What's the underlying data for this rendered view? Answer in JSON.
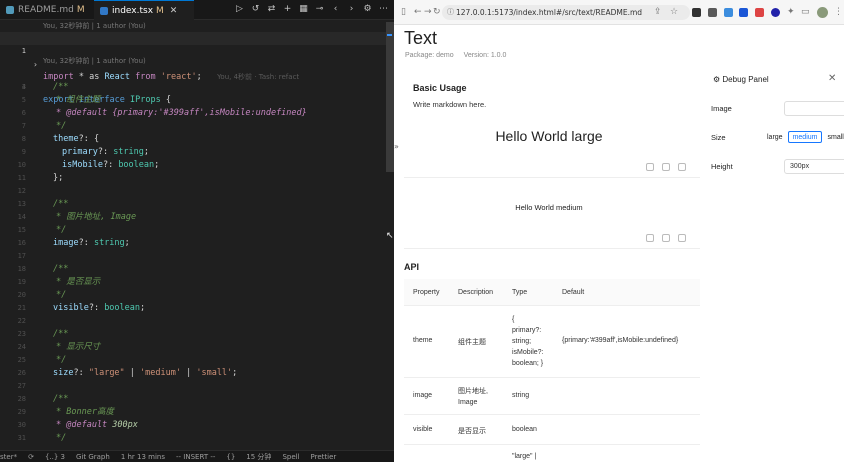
{
  "editor": {
    "tabs": [
      {
        "label": "README.md",
        "modified": "M",
        "icon_color": "#519aba"
      },
      {
        "label": "index.tsx",
        "modified": "M",
        "icon_color": "#3178c6"
      }
    ],
    "blame_top": "You, 32秒钟前 | 1 author (You)",
    "blame_mid": "You, 32秒钟前 | 1 author (You)",
    "ghost_text": "You, 4秒前 · Tash: refact",
    "line_numbers": [
      "1",
      "2",
      "3",
      "4",
      "5",
      "6",
      "7",
      "8",
      "9",
      "10",
      "11",
      "12",
      "13",
      "14",
      "15",
      "16",
      "17",
      "18",
      "19",
      "20",
      "21",
      "22",
      "23",
      "24",
      "25",
      "26",
      "27",
      "28",
      "29",
      "30",
      "31",
      "32"
    ],
    "code": {
      "l1": [
        "import",
        " * as ",
        "React",
        " from ",
        "'react'",
        ";"
      ],
      "l2_blank": "",
      "l3": [
        "export",
        " interface ",
        "IProps",
        " {"
      ],
      "l4": "/**",
      "l5": "* 组件主题",
      "l6_kw": "* @default",
      "l6_val": " {primary:'#399aff',isMobile:undefined}",
      "l7": "*/",
      "l8": [
        "theme",
        "?: {"
      ],
      "l9": [
        "primary",
        "?: ",
        "string",
        ";"
      ],
      "l10": [
        "isMobile",
        "?: ",
        "boolean",
        ";"
      ],
      "l11": "};",
      "l13": "/**",
      "l14": "* 图片地址, Image",
      "l15": "*/",
      "l16": [
        "image",
        "?: ",
        "string",
        ";"
      ],
      "l18": "/**",
      "l19": "* 是否显示",
      "l20": "*/",
      "l21": [
        "visible",
        "?: ",
        "boolean",
        ";"
      ],
      "l23": "/**",
      "l24": "* 显示尺寸",
      "l25": "*/",
      "l26": [
        "size",
        "?: ",
        "\"large\"",
        " | ",
        "'medium'",
        " | ",
        "'small'",
        ";"
      ],
      "l28": "/**",
      "l29": "* Bonner高度",
      "l30_kw": "* @default",
      "l30_val": " 300px",
      "l31": "*/"
    },
    "status": {
      "branch": "ster*",
      "sync": "⟳",
      "problems": "{..} 3",
      "git_graph": "Git Graph",
      "time": "1 hr 13 mins",
      "mode": "-- INSERT --",
      "braces": "{}",
      "ago": "15 分钟",
      "spell": "Spell",
      "prettier": "Prettier"
    }
  },
  "browser": {
    "url": "127.0.0.1:5173/index.html#/src/text/README.md",
    "doc_title": "Text",
    "package": "Package: demo",
    "version": "Version: 1.0.0",
    "basic_usage_title": "Basic Usage",
    "basic_usage_desc": "Write markdown here.",
    "demo_large": "Hello World large",
    "demo_medium": "Hello World medium",
    "api_title": "API",
    "table_headers": [
      "Property",
      "Description",
      "Type",
      "Default"
    ],
    "rows": [
      {
        "property": "theme",
        "description": "组件主题",
        "type_lines": [
          "{",
          "primary?:",
          "string;",
          "isMobile?:",
          "boolean; }"
        ],
        "default": "{primary:'#399aff',isMobile:undefined}"
      },
      {
        "property": "image",
        "description_lines": [
          "图片地址,",
          "Image"
        ],
        "type": "string",
        "default": ""
      },
      {
        "property": "visible",
        "description": "是否显示",
        "type": "boolean",
        "default": ""
      },
      {
        "property": "",
        "description": "",
        "type": "\"large\" |",
        "default": ""
      }
    ],
    "debug": {
      "title": "Debug Panel",
      "labels": {
        "image": "Image",
        "size": "Size",
        "height": "Height"
      },
      "image_value": "",
      "size_options": [
        "large",
        "medium",
        "small"
      ],
      "size_selected": "medium",
      "height_value": "300px"
    }
  }
}
